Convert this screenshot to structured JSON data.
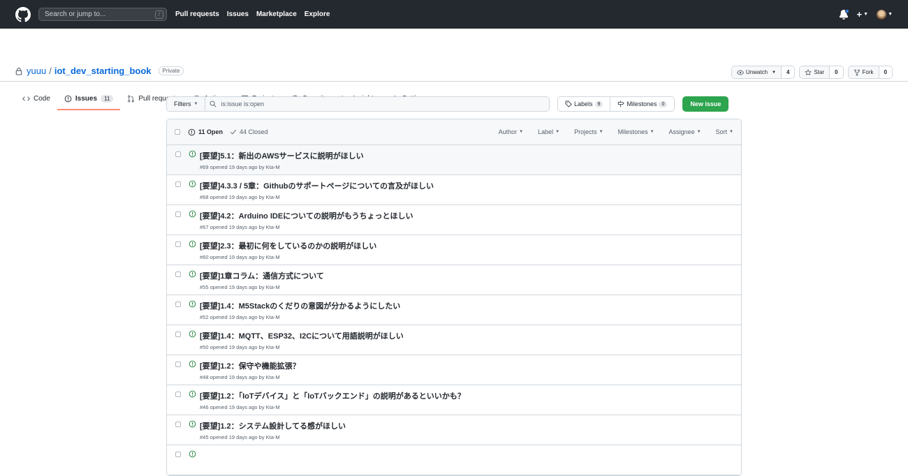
{
  "header": {
    "search_placeholder": "Search or jump to...",
    "search_shortcut": "/",
    "nav": [
      "Pull requests",
      "Issues",
      "Marketplace",
      "Explore"
    ],
    "plus_label": "+"
  },
  "repo": {
    "owner": "yuuu",
    "separator": "/",
    "name": "iot_dev_starting_book",
    "visibility": "Private",
    "watch": {
      "label": "Unwatch",
      "count": "4"
    },
    "star": {
      "label": "Star",
      "count": "0"
    },
    "fork": {
      "label": "Fork",
      "count": "0"
    }
  },
  "tabs": [
    {
      "label": "Code"
    },
    {
      "label": "Issues",
      "count": "11"
    },
    {
      "label": "Pull requests"
    },
    {
      "label": "Actions"
    },
    {
      "label": "Projects"
    },
    {
      "label": "Security"
    },
    {
      "label": "Insights"
    },
    {
      "label": "Settings"
    }
  ],
  "subnav": {
    "filters_label": "Filters",
    "query": "is:issue is:open",
    "labels": {
      "label": "Labels",
      "count": "9"
    },
    "milestones": {
      "label": "Milestones",
      "count": "0"
    },
    "new_issue": "New issue"
  },
  "list_header": {
    "open": "11 Open",
    "closed": "44 Closed",
    "filters": [
      "Author",
      "Label",
      "Projects",
      "Milestones",
      "Assignee",
      "Sort"
    ]
  },
  "issues": [
    {
      "title": "[要望]5.1：新出のAWSサービスに説明がほしい",
      "meta": "#69 opened 19 days ago by Kta-M"
    },
    {
      "title": "[要望]4.3.3 / 5章：Githubのサポートページについての言及がほしい",
      "meta": "#68 opened 19 days ago by Kta-M"
    },
    {
      "title": "[要望]4.2：Arduino IDEについての説明がもうちょっとほしい",
      "meta": "#67 opened 19 days ago by Kta-M"
    },
    {
      "title": "[要望]2.3：最初に何をしているのかの説明がほしい",
      "meta": "#60 opened 19 days ago by Kta-M"
    },
    {
      "title": "[要望]1章コラム：通信方式について",
      "meta": "#55 opened 19 days ago by Kta-M"
    },
    {
      "title": "[要望]1.4：M5Stackのくだりの意図が分かるようにしたい",
      "meta": "#52 opened 19 days ago by Kta-M"
    },
    {
      "title": "[要望]1.4：MQTT、ESP32、I2Cについて用語説明がほしい",
      "meta": "#50 opened 19 days ago by Kta-M"
    },
    {
      "title": "[要望]1.2：保守や機能拡張？",
      "meta": "#48 opened 19 days ago by Kta-M"
    },
    {
      "title": "[要望]1.2：「IoTデバイス」と「IoTバックエンド」の説明があるといいかも？",
      "meta": "#46 opened 19 days ago by Kta-M"
    },
    {
      "title": "[要望]1.2：システム設計してる感がほしい",
      "meta": "#45 opened 19 days ago by Kta-M"
    },
    {
      "title": "",
      "meta": ""
    }
  ]
}
